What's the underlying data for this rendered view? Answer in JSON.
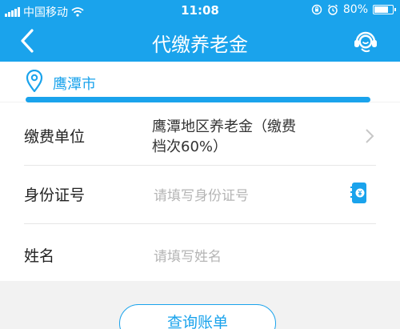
{
  "status_bar": {
    "carrier": "中国移动",
    "time": "11:08",
    "battery": "80%",
    "battery_level": 0.8
  },
  "header": {
    "title": "代缴养老金",
    "back_icon": "chevron-left-icon",
    "service_icon": "customer-service-icon"
  },
  "location": {
    "city": "鹰潭市",
    "icon": "location-pin-icon"
  },
  "form": {
    "unit": {
      "label": "缴费单位",
      "value_line1": "鹰潭地区养老金（缴费",
      "value_line2": "档次60%）"
    },
    "id_number": {
      "label": "身份证号",
      "placeholder": "请填写身份证号"
    },
    "name": {
      "label": "姓名",
      "placeholder": "请填写姓名"
    }
  },
  "actions": {
    "query_label": "查询账单"
  },
  "colors": {
    "primary": "#1aa3ec",
    "background": "#f2f2f2",
    "placeholder": "#b5b5b5"
  }
}
